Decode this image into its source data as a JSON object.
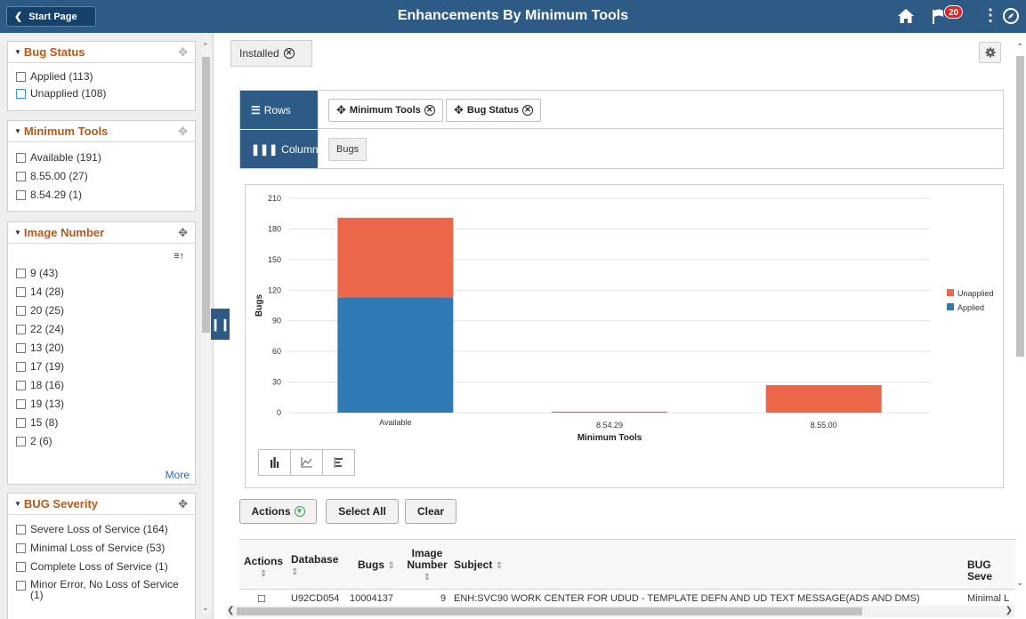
{
  "header": {
    "start_page_label": "Start Page",
    "title": "Enhancements By Minimum Tools",
    "notification_count": "20",
    "icons": [
      "home-icon",
      "flag-icon",
      "more-icon",
      "navigator-icon"
    ]
  },
  "facets": [
    {
      "title": "Bug Status",
      "options": [
        "Applied (113)",
        "Unapplied (108)"
      ]
    },
    {
      "title": "Minimum Tools",
      "options": [
        "Available (191)",
        "8.55.00 (27)",
        "8.54.29 (1)"
      ]
    },
    {
      "title": "Image Number",
      "options": [
        "9 (43)",
        "14 (28)",
        "20 (25)",
        "22 (24)",
        "13 (20)",
        "17 (19)",
        "18 (16)",
        "19 (13)",
        "15 (8)",
        "2 (6)"
      ],
      "more_label": "More"
    },
    {
      "title": "BUG Severity",
      "options": [
        "Severe Loss of Service (164)",
        "Minimal Loss of Service (53)",
        "Complete Loss of Service (1)",
        "Minor Error, No Loss of Service (1)"
      ]
    }
  ],
  "filter_chip": "Installed",
  "pivot": {
    "rows_label": "Rows",
    "row_fields": [
      "Minimum Tools",
      "Bug Status"
    ],
    "columns_label": "Columns",
    "column_fields": [
      "Bugs"
    ]
  },
  "chart_data": {
    "type": "bar",
    "stacked": true,
    "categories": [
      "Available",
      "8.54.29",
      "8.55.00"
    ],
    "series": [
      {
        "name": "Applied",
        "color": "#2f7ab4",
        "values": [
          113,
          0,
          0
        ]
      },
      {
        "name": "Unapplied",
        "color": "#ec674a",
        "values": [
          78,
          1,
          27
        ]
      }
    ],
    "xlabel": "Minimum Tools",
    "ylabel": "Bugs",
    "ylim": [
      0,
      210
    ],
    "yticks": [
      0,
      30,
      60,
      90,
      120,
      150,
      180,
      210
    ],
    "grid": true,
    "legend_position": "right"
  },
  "actions": {
    "actions_label": "Actions",
    "select_all_label": "Select All",
    "clear_label": "Clear"
  },
  "grid": {
    "columns": [
      "Actions",
      "Database",
      "Bugs",
      "Image Number",
      "Subject",
      "BUG Seve"
    ],
    "partial_row": {
      "database": "U92CD054",
      "bug": "10004137",
      "image": "9",
      "subject": "ENH:SVC90 WORK CENTER FOR UDUD - TEMPLATE DEFN AND UD TEXT MESSAGE(ADS AND DMS)",
      "severity": "Minimal L"
    }
  }
}
